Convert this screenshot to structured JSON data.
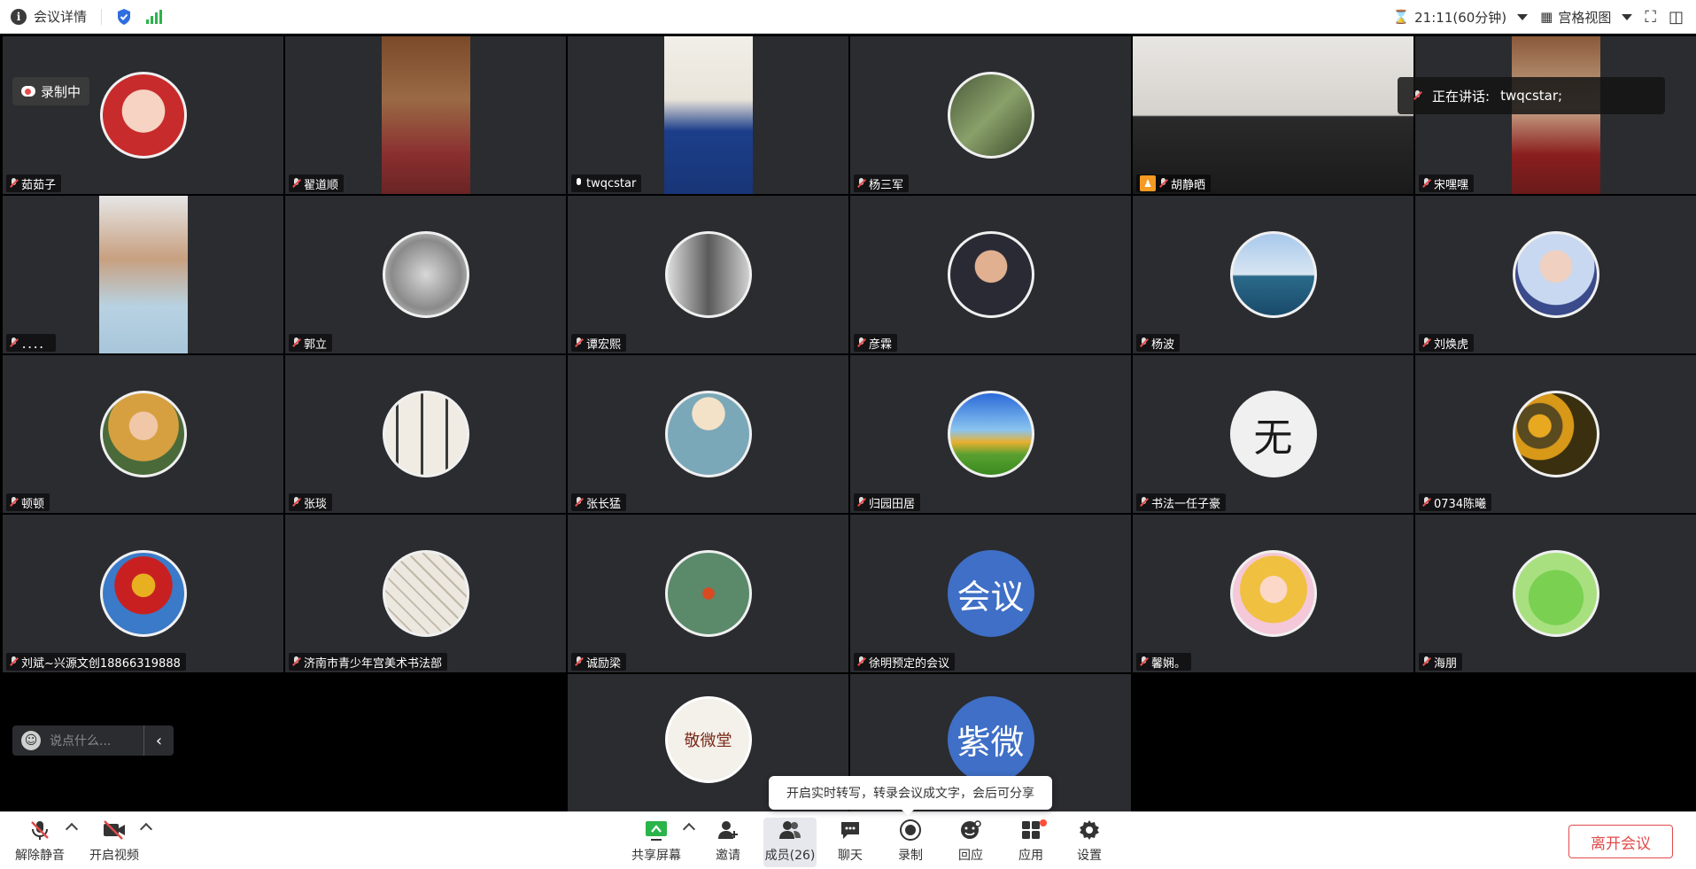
{
  "topbar": {
    "title": "会议详情",
    "timer": "21:11(60分钟)",
    "view_mode": "宫格视图"
  },
  "recording_badge": "录制中",
  "speaking": {
    "label": "正在讲话:",
    "name": "twqcstar;"
  },
  "chat": {
    "placeholder": "说点什么..."
  },
  "tooltip": "开启实时转写，转录会议成文字，会后可分享",
  "participants": [
    {
      "name": "茹茹子"
    },
    {
      "name": "翟道顺"
    },
    {
      "name": "twqcstar"
    },
    {
      "name": "杨三军"
    },
    {
      "name": "胡静晒"
    },
    {
      "name": "宋嘿嘿"
    },
    {
      "name": "．．．．"
    },
    {
      "name": "郭立"
    },
    {
      "name": "谭宏熙"
    },
    {
      "name": "彦霖"
    },
    {
      "name": "杨波"
    },
    {
      "name": "刘焕虎"
    },
    {
      "name": "顿顿"
    },
    {
      "name": "张琰"
    },
    {
      "name": "张长猛"
    },
    {
      "name": "归园田居"
    },
    {
      "name": "书法一任子豪"
    },
    {
      "name": "0734陈曦"
    },
    {
      "name": "刘斌~兴源文创18866319888"
    },
    {
      "name": "济南市青少年宫美术书法部"
    },
    {
      "name": "诚励梁"
    },
    {
      "name": "徐明预定的会议"
    },
    {
      "name": "馨娴。"
    },
    {
      "name": "海朋"
    }
  ],
  "avatar_text": {
    "meeting": "会议",
    "ziwei": "紫微",
    "seal": "敬微堂"
  },
  "toolbar": {
    "unmute": "解除静音",
    "start_video": "开启视频",
    "share_screen": "共享屏幕",
    "invite": "邀请",
    "members": "成员(26)",
    "chat": "聊天",
    "record": "录制",
    "react": "回应",
    "apps": "应用",
    "settings": "设置",
    "leave": "离开会议"
  },
  "colors": {
    "accent": "#3f6fc6",
    "danger": "#e24a4a",
    "host": "#f59a23",
    "signal": "#2bb44a"
  }
}
